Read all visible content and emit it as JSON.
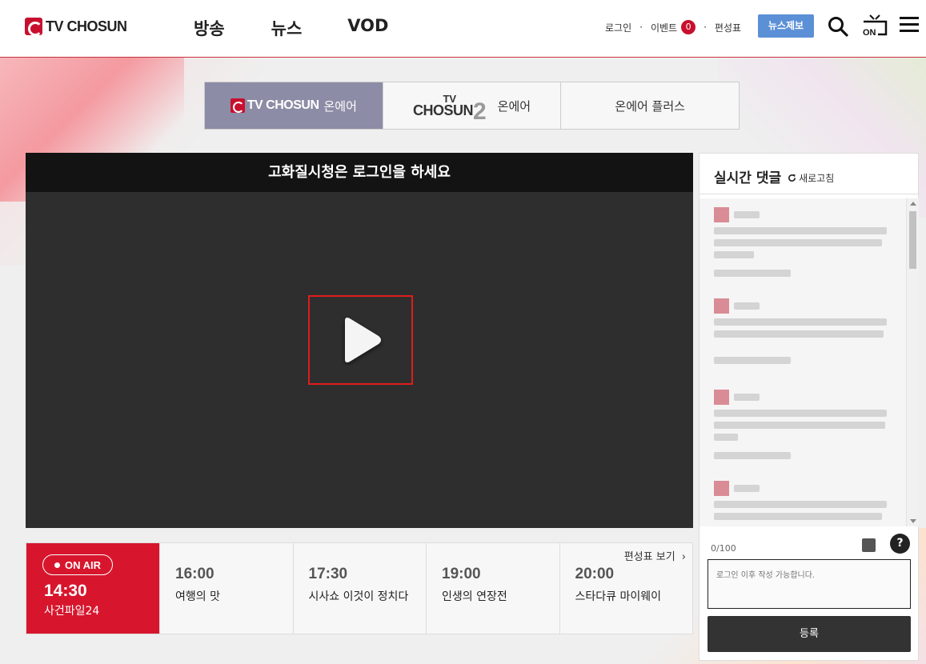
{
  "header": {
    "logo_text": "TV CHOSUN",
    "nav": [
      "방송",
      "뉴스",
      "VOD"
    ],
    "login": "로그인",
    "event": "이벤트",
    "event_count": "0",
    "schedule": "편성표",
    "news_tip": "뉴스제보",
    "on_label": "ON"
  },
  "channel_tabs": [
    {
      "logo": "TV CHOSUN",
      "label": "온에어",
      "active": true
    },
    {
      "logo_small": "TV",
      "logo_big": "CHOSUN",
      "logo_num": "2",
      "label": "온에어",
      "active": false
    },
    {
      "label": "온에어 플러스",
      "active": false
    }
  ],
  "player": {
    "banner": "고화질시청은 로그인을 하세요"
  },
  "schedule": {
    "onair_badge": "ON AIR",
    "current_time": "14:30",
    "current_program": "사건파일24",
    "link": "편성표 보기",
    "slots": [
      {
        "time": "16:00",
        "program": "여행의 맛"
      },
      {
        "time": "17:30",
        "program": "시사쇼 이것이 정치다"
      },
      {
        "time": "19:00",
        "program": "인생의 연장전"
      },
      {
        "time": "20:00",
        "program": "스타다큐 마이웨이"
      }
    ]
  },
  "comments": {
    "title": "실시간 댓글",
    "refresh": "새로고침",
    "count": "0/100",
    "placeholder": "로그인 이후 작성 가능합니다.",
    "submit": "등록",
    "help": "?"
  },
  "colors": {
    "brand_red": "#d7162d",
    "active_tab": "#8d8ca6",
    "news_tip": "#5b90d7"
  }
}
